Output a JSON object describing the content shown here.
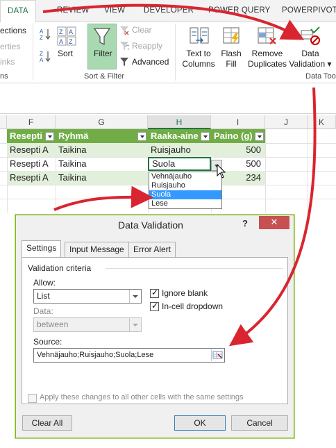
{
  "ribbon": {
    "tabs": [
      "DATA",
      "REVIEW",
      "VIEW",
      "DEVELOPER",
      "POWER QUERY",
      "POWERPIVOT"
    ],
    "left_fragments": [
      "ections",
      "erties",
      "inks",
      "ns"
    ],
    "sort_az": "A↓Z",
    "sort_label": "Sort",
    "filter_label": "Filter",
    "clear_label": "Clear",
    "reapply_label": "Reapply",
    "advanced_label": "Advanced",
    "sort_filter_group": "Sort & Filter",
    "text_to_columns": [
      "Text to",
      "Columns"
    ],
    "flash_fill": [
      "Flash",
      "Fill"
    ],
    "remove_duplicates": [
      "Remove",
      "Duplicates"
    ],
    "data_validation": [
      "Data",
      "Validation ▾"
    ],
    "data_tools_group": "Data Too"
  },
  "sheet": {
    "columns": [
      "F",
      "G",
      "H",
      "I",
      "J",
      "K"
    ],
    "headers": [
      "Resepti",
      "Ryhmä",
      "Raaka-aine",
      "Paino (g)"
    ],
    "rows": [
      [
        "Resepti A",
        "Taikina",
        "Ruisjauho",
        "500"
      ],
      [
        "Resepti A",
        "Taikina",
        "Suola",
        "500"
      ],
      [
        "Resepti A",
        "Taikina",
        "",
        "234"
      ]
    ],
    "dropdown_items": [
      "Vehnäjauho",
      "Ruisjauho",
      "Suola",
      "Lese"
    ],
    "dropdown_selected": "Suola"
  },
  "dialog": {
    "title": "Data Validation",
    "help": "?",
    "close": "✕",
    "tabs": [
      "Settings",
      "Input Message",
      "Error Alert"
    ],
    "section": "Validation criteria",
    "allow_label": "Allow:",
    "allow_value": "List",
    "data_label": "Data:",
    "data_value": "between",
    "ignore_blank": "Ignore blank",
    "in_cell_dropdown": "In-cell dropdown",
    "source_label": "Source:",
    "source_value": "Vehnäjauho;Ruisjauho;Suola;Lese",
    "apply_all": "Apply these changes to all other cells with the same settings",
    "clear_all": "Clear All",
    "ok": "OK",
    "cancel": "Cancel"
  },
  "colors": {
    "excel_green": "#217346",
    "table_header": "#70ad47",
    "band": "#e2efda",
    "arrow_red": "#d9252f",
    "selection": "#3399ff"
  }
}
